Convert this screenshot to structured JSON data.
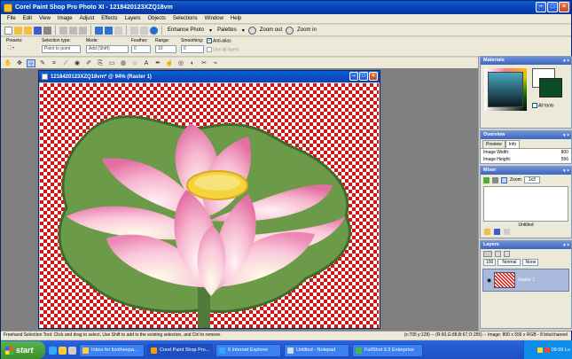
{
  "window": {
    "title": "Corel Paint Shop Pro Photo XI - 1218420123XZQ18vm"
  },
  "menu": [
    "File",
    "Edit",
    "View",
    "Image",
    "Adjust",
    "Effects",
    "Layers",
    "Objects",
    "Selections",
    "Window",
    "Help"
  ],
  "toolbar": {
    "enhance_label": "Enhance Photo",
    "palettes_label": "Palettes",
    "zoom_out_label": "Zoom out",
    "zoom_in_label": "Zoom in"
  },
  "options": {
    "presets_label": "Presets:",
    "selection_type_label": "Selection type:",
    "selection_type_value": "Point to point",
    "mode_label": "Mode:",
    "mode_value": "Add (Shift)",
    "feather_label": "Feather:",
    "feather_value": "0",
    "range_label": "Range:",
    "range_value": "10",
    "smoothing_label": "Smoothing:",
    "smoothing_value": "0",
    "antialias_label": "Anti-alias",
    "use_all_layers_label": "Use all layers"
  },
  "image_window": {
    "title": "1218420123XZQ18vm* @ 94% (Raster 1)"
  },
  "palettes": {
    "materials_title": "Materials",
    "all_tools_label": "All tools",
    "overview_title": "Overview",
    "preview_tab": "Preview",
    "info_tab": "Info",
    "image_width_label": "Image Width:",
    "image_width_value": "800",
    "image_height_label": "Image Height:",
    "image_height_value": "556",
    "mixer_title": "Mixer",
    "mixer_zoom_label": "Zoom",
    "mixer_zoom_value": "1x3",
    "mixer_untitled": "Untitled",
    "layers_title": "Layers",
    "layer_opacity": "100",
    "layer_blend": "Normal",
    "layer_lock": "None",
    "layer_name": "Raster 1"
  },
  "status": {
    "left": "Freehand Selection Tool: Click and drag to select. Use Shift to add to the existing selection, and Ctrl to remove.",
    "right": "(x:705 y:128) -- (R:60,G:88,B:67,O:255) -- Image: 800 x 556 x RGB - 8 bits/channel"
  },
  "taskbar": {
    "start_label": "start",
    "tasks": [
      {
        "label": "Inbox for lizotheepa...",
        "color": "#ffcc33"
      },
      {
        "label": "Corel Paint Shop Pro...",
        "color": "#ff9900"
      },
      {
        "label": "6 Internet Explorer",
        "color": "#33aaff"
      },
      {
        "label": "Untitled - Notepad",
        "color": "#ccddee"
      },
      {
        "label": "FullShot 9.3 Enterprise",
        "color": "#44bb44"
      }
    ],
    "clock": "09:09 Lu"
  },
  "colors": {
    "checker": "#e01010",
    "title_bar": "#0a3fb0",
    "foreground_swatch": "#0d4d25",
    "background_swatch": "#ffffff"
  }
}
